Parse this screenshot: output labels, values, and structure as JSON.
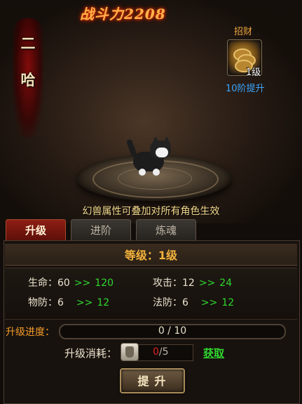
{
  "header": {
    "power_title": "战斗力2208"
  },
  "pet": {
    "name_chars": [
      "二",
      "哈"
    ]
  },
  "skill": {
    "label": "招财",
    "level": "1级",
    "tip": "10阶提升",
    "icon": "coins-icon"
  },
  "notice": "幻兽属性可叠加对所有角色生效",
  "tabs": [
    {
      "label": "升级",
      "active": true
    },
    {
      "label": "进阶",
      "active": false
    },
    {
      "label": "炼魂",
      "active": false
    }
  ],
  "level": "等级：1级",
  "stats": [
    {
      "label": "生命：60",
      "arrow": ">>",
      "next": "120"
    },
    {
      "label": "攻击：12",
      "arrow": ">>",
      "next": "24"
    },
    {
      "label": "物防：6",
      "arrow": ">>",
      "next": "12"
    },
    {
      "label": "法防：6",
      "arrow": ">>",
      "next": "12"
    }
  ],
  "progress": {
    "label": "升级进度：",
    "text": "0 / 10",
    "value": 0,
    "max": 10
  },
  "cost": {
    "label": "升级消耗：",
    "have": "0",
    "sep": "/5",
    "icon": "material-bag-icon"
  },
  "get_link": "获取",
  "upgrade_button": "提升",
  "colors": {
    "accent_orange": "#f3b23c",
    "green": "#2fd82f",
    "blue": "#3aa6ff",
    "tab_active": "#8e1e14"
  }
}
